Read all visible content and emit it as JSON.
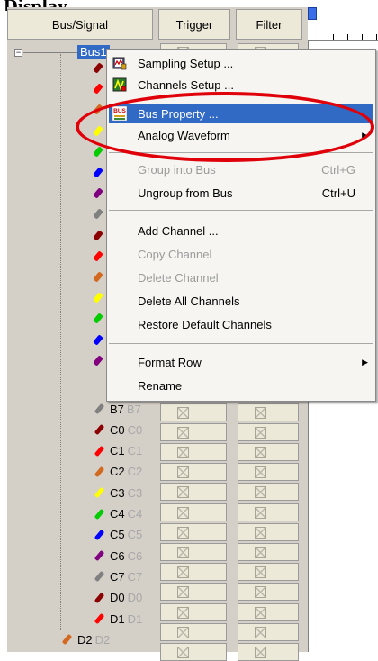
{
  "caption": "Display",
  "columns": {
    "bus_signal": "Bus/Signal",
    "trigger": "Trigger",
    "filter": "Filter"
  },
  "tree": {
    "collapse": "−",
    "bus_name": "Bus1"
  },
  "signals": [
    {
      "name": "B7",
      "ghost": "B7",
      "color": "#808080"
    },
    {
      "name": "C0",
      "ghost": "C0",
      "color": "#8b0000"
    },
    {
      "name": "C1",
      "ghost": "C1",
      "color": "#ff0000"
    },
    {
      "name": "C2",
      "ghost": "C2",
      "color": "#d2691e"
    },
    {
      "name": "C3",
      "ghost": "C3",
      "color": "#ffff00"
    },
    {
      "name": "C4",
      "ghost": "C4",
      "color": "#00cc00"
    },
    {
      "name": "C5",
      "ghost": "C5",
      "color": "#0000ff"
    },
    {
      "name": "C6",
      "ghost": "C6",
      "color": "#800080"
    },
    {
      "name": "C7",
      "ghost": "C7",
      "color": "#808080"
    },
    {
      "name": "D0",
      "ghost": "D0",
      "color": "#8b0000"
    },
    {
      "name": "D1",
      "ghost": "D1",
      "color": "#ff0000"
    },
    {
      "name": "D2",
      "ghost": "D2",
      "color": "#d2691e"
    }
  ],
  "hidden_probe_colors": [
    "#8b0000",
    "#ff0000",
    "#d2691e",
    "#ffff00",
    "#00cc00",
    "#0000ff",
    "#800080",
    "#808080",
    "#8b0000",
    "#ff0000",
    "#d2691e",
    "#ffff00",
    "#00cc00",
    "#0000ff",
    "#800080"
  ],
  "menu": {
    "sampling_setup": "Sampling Setup ...",
    "channels_setup": "Channels Setup ...",
    "bus_property": "Bus Property ...",
    "bus_icon_text": "BUS",
    "analog_waveform": "Analog Waveform",
    "group_into_bus": "Group into Bus",
    "group_into_bus_shortcut": "Ctrl+G",
    "ungroup_from_bus": "Ungroup from Bus",
    "ungroup_from_bus_shortcut": "Ctrl+U",
    "add_channel": "Add Channel ...",
    "copy_channel": "Copy Channel",
    "delete_channel": "Delete Channel",
    "delete_all_channels": "Delete All Channels",
    "restore_default_channels": "Restore Default Channels",
    "format_row": "Format Row",
    "rename": "Rename"
  },
  "colors": {
    "selection": "#316ac5",
    "highlight_ring": "#e0000a",
    "menu_bg": "#f6f5f1"
  }
}
